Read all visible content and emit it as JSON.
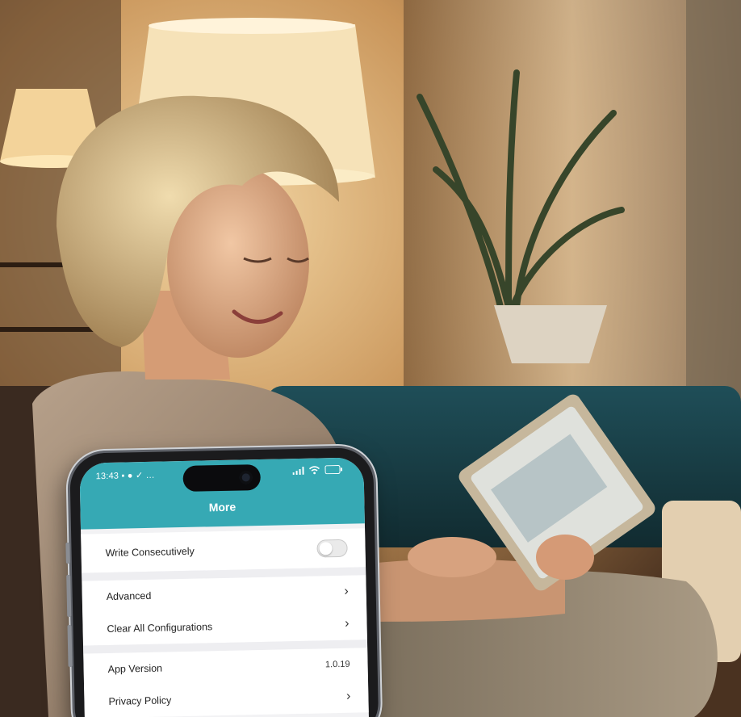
{
  "phone": {
    "status_time": "13:43",
    "status_icons": "▪ ● ✓ …",
    "screen_title": "More",
    "rows": [
      {
        "label": "Write Consecutively",
        "control": "toggle",
        "toggle_on": false
      },
      {
        "label": "Advanced",
        "control": "chevron"
      },
      {
        "label": "Clear All Configurations",
        "control": "chevron"
      },
      {
        "label": "App Version",
        "control": "value",
        "value": "1.0.19"
      },
      {
        "label": "Privacy Policy",
        "control": "chevron"
      }
    ],
    "chevron_glyph": "›"
  },
  "colors": {
    "header_teal": "#36a9b4"
  }
}
